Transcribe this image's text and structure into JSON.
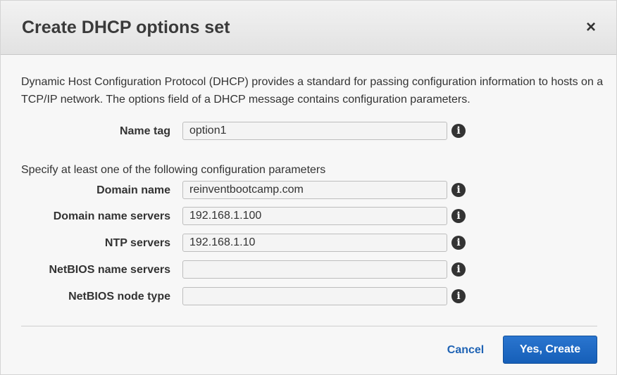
{
  "dialog": {
    "title": "Create DHCP options set",
    "close_symbol": "×",
    "description": "Dynamic Host Configuration Protocol (DHCP) provides a standard for passing configuration information to hosts on a TCP/IP network. The options field of a DHCP message contains configuration parameters.",
    "hint": "Specify at least one of the following configuration parameters"
  },
  "fields": {
    "name_tag": {
      "label": "Name tag",
      "value": "option1"
    },
    "domain_name": {
      "label": "Domain name",
      "value": "reinventbootcamp.com"
    },
    "domain_name_servers": {
      "label": "Domain name servers",
      "value": "192.168.1.100"
    },
    "ntp_servers": {
      "label": "NTP servers",
      "value": "192.168.1.10"
    },
    "netbios_name_servers": {
      "label": "NetBIOS name servers",
      "value": ""
    },
    "netbios_node_type": {
      "label": "NetBIOS node type",
      "value": ""
    }
  },
  "info_symbol": "i",
  "icons": {
    "close": "close-icon",
    "info": "info-icon"
  },
  "actions": {
    "cancel_label": "Cancel",
    "create_label": "Yes, Create"
  },
  "colors": {
    "primary_button": "#1f6bc6",
    "link": "#1f63b4"
  }
}
